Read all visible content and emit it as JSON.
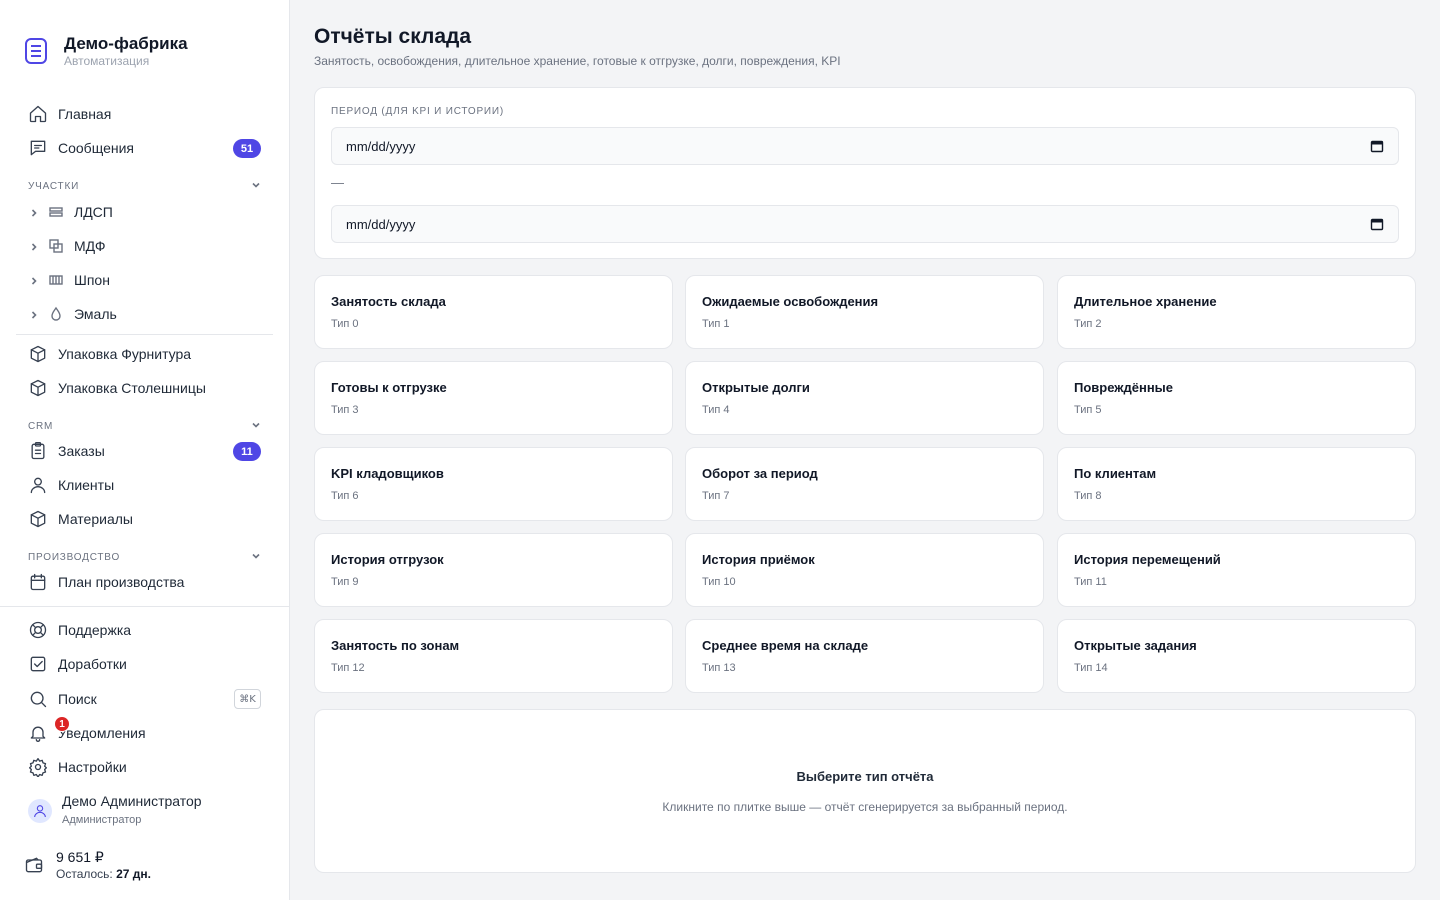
{
  "brand": {
    "name": "Демо-фабрика",
    "subtitle": "Автоматизация",
    "logo_icon": "factory-icon"
  },
  "nav_top": [
    {
      "label": "Главная",
      "icon": "home-icon"
    },
    {
      "label": "Сообщения",
      "icon": "chat-icon",
      "badge": "51"
    }
  ],
  "section_areas": {
    "label": "Участки"
  },
  "areas": [
    {
      "label": "ЛДСП",
      "icon": "layers-icon"
    },
    {
      "label": "МДФ",
      "icon": "copy-icon"
    },
    {
      "label": "Шпон",
      "icon": "barcode-icon"
    },
    {
      "label": "Эмаль",
      "icon": "drop-icon"
    }
  ],
  "packing": [
    {
      "label": "Упаковка Фурнитура",
      "icon": "box-icon"
    },
    {
      "label": "Упаковка Столешницы",
      "icon": "box-icon"
    }
  ],
  "section_crm": {
    "label": "CRM"
  },
  "crm": [
    {
      "label": "Заказы",
      "icon": "clipboard-icon",
      "badge": "11"
    },
    {
      "label": "Клиенты",
      "icon": "user-icon"
    },
    {
      "label": "Материалы",
      "icon": "cube-icon"
    }
  ],
  "section_production": {
    "label": "Производство"
  },
  "production": [
    {
      "label": "План производства",
      "icon": "calendar-icon"
    }
  ],
  "bottom_nav": {
    "support": "Поддержка",
    "improvements": "Доработки",
    "search": "Поиск",
    "search_shortcut": "⌘K",
    "notifications": "Уведомления",
    "notifications_count": "1",
    "settings": "Настройки"
  },
  "user": {
    "name": "Демо Администратор",
    "role": "Администратор"
  },
  "wallet": {
    "amount": "9 651 ₽",
    "left_label": "Осталось:",
    "left_value": "27 дн."
  },
  "page": {
    "title": "Отчёты склада",
    "subtitle": "Занятость, освобождения, длительное хранение, готовые к отгрузке, долги, повреждения, KPI"
  },
  "period": {
    "label": "Период (для KPI и истории)",
    "from_placeholder": "mm/dd/yyyy",
    "separator": "—",
    "to_placeholder": "mm/dd/yyyy"
  },
  "report_tiles": [
    {
      "title": "Занятость склада",
      "type": "Тип 0"
    },
    {
      "title": "Ожидаемые освобождения",
      "type": "Тип 1"
    },
    {
      "title": "Длительное хранение",
      "type": "Тип 2"
    },
    {
      "title": "Готовы к отгрузке",
      "type": "Тип 3"
    },
    {
      "title": "Открытые долги",
      "type": "Тип 4"
    },
    {
      "title": "Повреждённые",
      "type": "Тип 5"
    },
    {
      "title": "KPI кладовщиков",
      "type": "Тип 6"
    },
    {
      "title": "Оборот за период",
      "type": "Тип 7"
    },
    {
      "title": "По клиентам",
      "type": "Тип 8"
    },
    {
      "title": "История отгрузок",
      "type": "Тип 9"
    },
    {
      "title": "История приёмок",
      "type": "Тип 10"
    },
    {
      "title": "История перемещений",
      "type": "Тип 11"
    },
    {
      "title": "Занятость по зонам",
      "type": "Тип 12"
    },
    {
      "title": "Среднее время на складе",
      "type": "Тип 13"
    },
    {
      "title": "Открытые задания",
      "type": "Тип 14"
    }
  ],
  "empty_state": {
    "title": "Выберите тип отчёта",
    "subtitle": "Кликните по плитке выше — отчёт сгенерируется за выбранный период."
  },
  "colors": {
    "accent": "#4f46e5",
    "danger": "#dc2626",
    "background": "#f3f4f6"
  }
}
